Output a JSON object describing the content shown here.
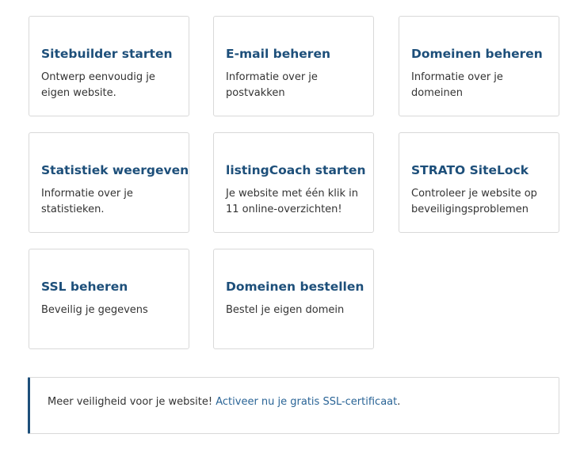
{
  "cards": [
    {
      "title": "Sitebuilder starten",
      "description": "Ontwerp eenvoudig je eigen website."
    },
    {
      "title": "E-mail beheren",
      "description": "Informatie over je postvakken"
    },
    {
      "title": "Domeinen beheren",
      "description": "Informatie over je domeinen"
    },
    {
      "title": "Statistiek weergeven",
      "description": "Informatie over je statistieken."
    },
    {
      "title": "listingCoach starten",
      "description": "Je website met één klik in 11 online-overzichten!"
    },
    {
      "title": "STRATO SiteLock",
      "description": "Controleer je website op beveiligingsproblemen"
    },
    {
      "title": "SSL beheren",
      "description": "Beveilig je gegevens"
    },
    {
      "title": "Domeinen bestellen",
      "description": "Bestel je eigen domein"
    }
  ],
  "notice": {
    "text": "Meer veiligheid voor je website! ",
    "link": "Activeer nu je gratis SSL-certificaat",
    "suffix": "."
  },
  "colors": {
    "title": "#1d4f7a",
    "link": "#2a6496",
    "border": "#d9d9d9",
    "accent_bar": "#1d4f7a"
  }
}
